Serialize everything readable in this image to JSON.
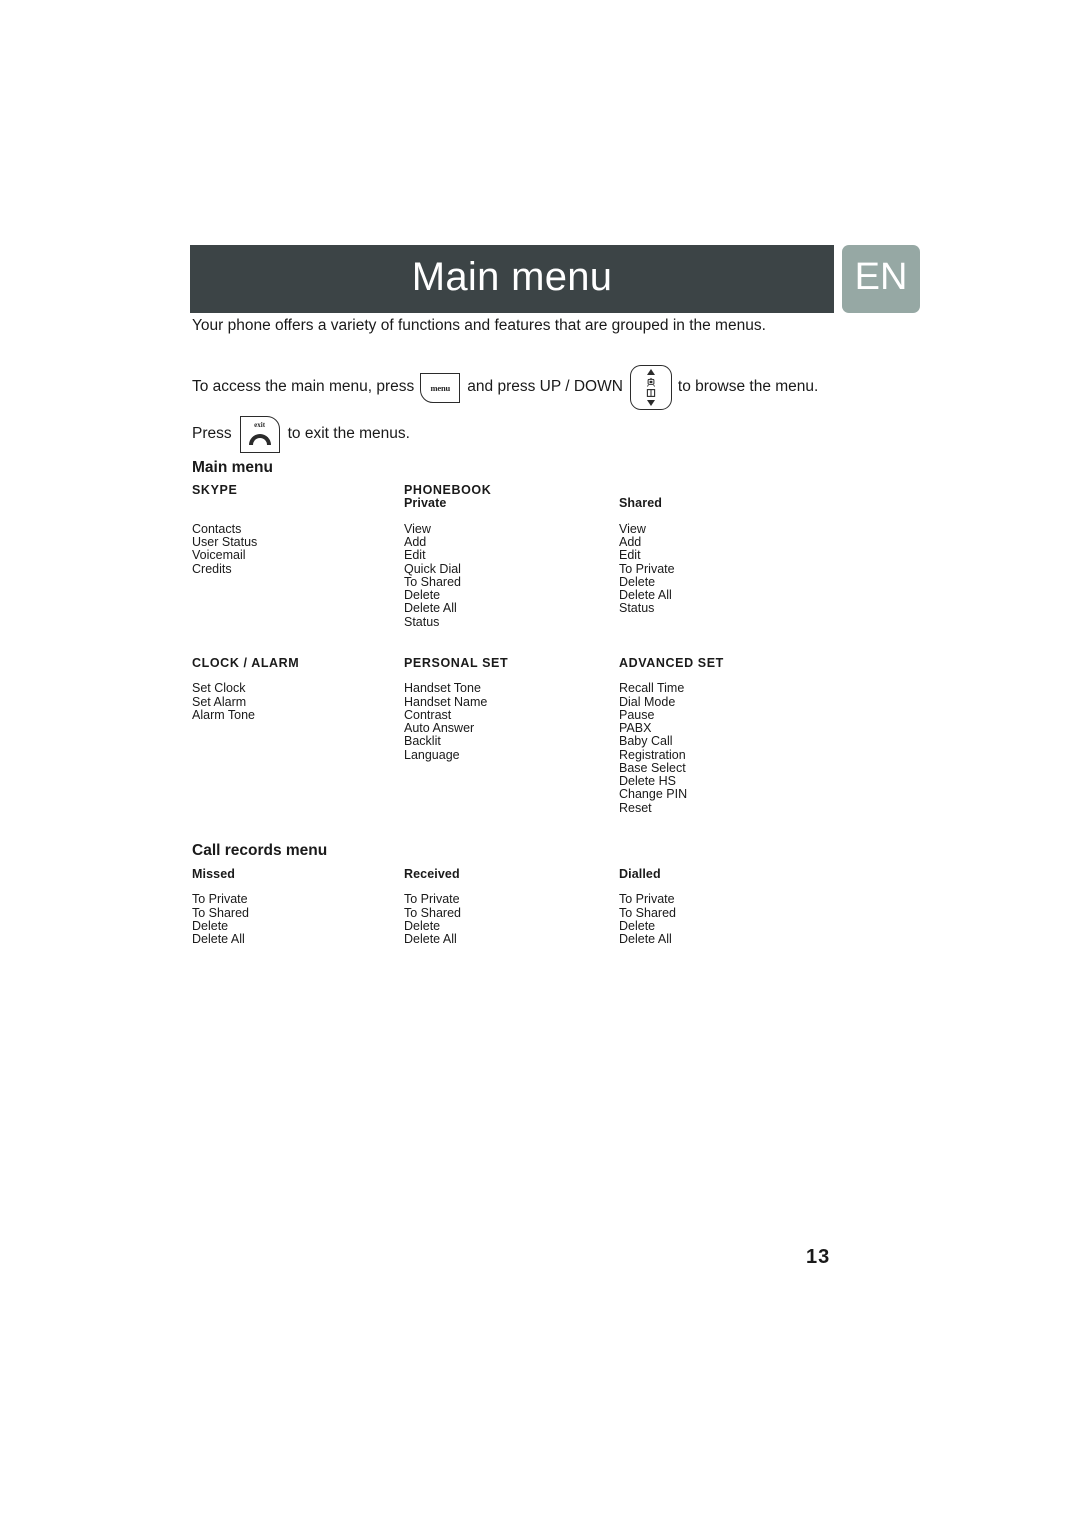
{
  "header": {
    "title": "Main menu",
    "language_badge": "EN",
    "bar_color": "#3C4446",
    "badge_color": "#96A8A4"
  },
  "intro": {
    "line1": "Your phone offers a variety of functions and features that are grouped in the menus.",
    "line2_a": "To access the main menu, press",
    "line2_b": "and press  UP / DOWN",
    "line2_c": "to browse the menu.",
    "line3_a": "Press",
    "line3_b": "to exit the menus."
  },
  "keys": {
    "menu_label": "menu",
    "exit_label": "exit"
  },
  "main_menu": {
    "title": "Main menu",
    "row1": [
      {
        "head": "SKYPE",
        "sub": "",
        "items": [
          "Contacts",
          "User Status",
          "Voicemail",
          "Credits"
        ]
      },
      {
        "head": "PHONEBOOK",
        "sub": "Private",
        "items": [
          "View",
          "Add",
          "Edit",
          "Quick Dial",
          "To Shared",
          "Delete",
          "Delete All",
          "Status"
        ]
      },
      {
        "head": "",
        "sub": "Shared",
        "items": [
          "View",
          "Add",
          "Edit",
          "To Private",
          "Delete",
          "Delete All",
          "Status"
        ]
      }
    ],
    "row2": [
      {
        "head": "CLOCK / ALARM",
        "sub": "",
        "items": [
          "Set Clock",
          "Set Alarm",
          "Alarm Tone"
        ]
      },
      {
        "head": "PERSONAL SET",
        "sub": "",
        "items": [
          "Handset Tone",
          "Handset Name",
          "Contrast",
          "Auto Answer",
          "Backlit",
          "Language"
        ]
      },
      {
        "head": "ADVANCED SET",
        "sub": "",
        "items": [
          "Recall Time",
          "Dial Mode",
          "Pause",
          "PABX",
          "Baby Call",
          "Registration",
          "Base Select",
          "Delete HS",
          "Change PIN",
          "Reset"
        ]
      }
    ]
  },
  "call_records_menu": {
    "title": "Call records menu",
    "columns": [
      {
        "head": "",
        "sub": "Missed",
        "items": [
          "To Private",
          "To Shared",
          "Delete",
          "Delete All"
        ]
      },
      {
        "head": "",
        "sub": "Received",
        "items": [
          "To Private",
          "To Shared",
          "Delete",
          "Delete All"
        ]
      },
      {
        "head": "",
        "sub": "Dialled",
        "items": [
          "To Private",
          "To Shared",
          "Delete",
          "Delete All"
        ]
      }
    ]
  },
  "footer": {
    "page_number": "13"
  }
}
